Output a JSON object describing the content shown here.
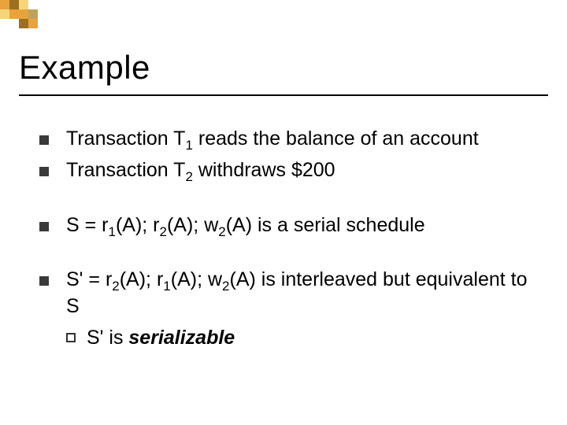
{
  "title": "Example",
  "bullets": {
    "b1_pre": "Transaction T",
    "b1_sub": "1",
    "b1_post": " reads the balance of an account",
    "b2_pre": "Transaction T",
    "b2_sub": "2",
    "b2_post": " withdraws $200",
    "b3_pre": "S =  r",
    "b3_s1": "1",
    "b3_m1": "(A); r",
    "b3_s2": "2",
    "b3_m2": "(A); w",
    "b3_s3": "2",
    "b3_post": "(A) is a serial schedule",
    "b4_pre": "S' =  r",
    "b4_s1": "2",
    "b4_m1": "(A); r",
    "b4_s2": "1",
    "b4_m2": "(A); w",
    "b4_s3": "2",
    "b4_post": "(A) is interleaved but equivalent to S",
    "sub_pre": "S' is ",
    "sub_em": "serializable"
  }
}
